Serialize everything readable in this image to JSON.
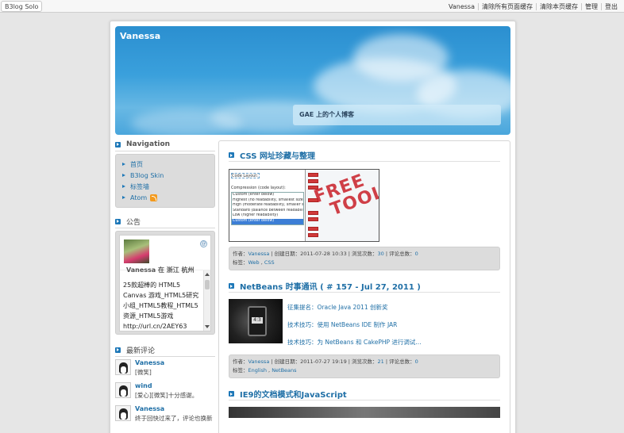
{
  "topbar": {
    "brand": "B3log Solo",
    "links": [
      "Vanessa",
      "清除所有页面缓存",
      "清除本页缓存",
      "管理",
      "登出"
    ]
  },
  "header": {
    "title": "Vanessa",
    "subtitle": "GAE 上的个人博客"
  },
  "sidebar": {
    "navigation": {
      "title": "Navigation",
      "items": [
        "首页",
        "B3log Skin",
        "标签墙",
        "Atom"
      ]
    },
    "notice": {
      "title": "公告",
      "widget_name": "Vanessa 在 浙江 杭州",
      "widget_text": "25款超棒的 HTML5 Canvas 游戏_HTML5研究小组_HTML5教程_HTML5资源_HTML5游戏 http://url.cn/2AEY63"
    },
    "recent_comments": {
      "title": "最新评论",
      "items": [
        {
          "name": "Vanessa",
          "text": "[微笑]"
        },
        {
          "name": "wind",
          "text": "[爱心][微笑]十分感谢。"
        },
        {
          "name": "Vanessa",
          "text": "终于回快过来了，评论也换新"
        }
      ]
    }
  },
  "posts": [
    {
      "title": "CSS 网址珍藏与整理",
      "meta_author_label": "作者：",
      "author": "Vanessa",
      "meta_created": " | 创建日期：2011-07-28 10:33 | 浏览次数：",
      "views": "30",
      "meta_comments": " | 评论总数：",
      "comments": "0",
      "tags_label": "标签：",
      "tags": [
        "Web",
        "CSS"
      ],
      "image": {
        "code_layout": "Code Layout:",
        "compression_label": "Compression (code layout):",
        "select_value": "Custom (enter below)",
        "options": [
          "Custom (enter below)",
          "Highest (no readability, smallest size)",
          "High (moderate readability, smaller size)",
          "Standard (balance between readability",
          "Low (higher readability)",
          "Custom (enter below)"
        ],
        "stamp_line1": "FREE",
        "stamp_line2": "TOOL"
      }
    },
    {
      "title": "NetBeans 时事通讯 ( # 157 - Jul 27, 2011 )",
      "links": [
        "征集提名：Oracle Java 2011 创新奖",
        "技术技巧：使用 NetBeans IDE 制作 JAR",
        "技术技巧：为 NetBeans 和 CakePHP 进行调试..."
      ],
      "phone_text": "4:3",
      "meta_author_label": "作者：",
      "author": "Vanessa",
      "meta_created": " | 创建日期：2011-07-27 19:19 | 浏览次数：",
      "views": "21",
      "meta_comments": " | 评论总数：",
      "comments": "0",
      "tags_label": "标签：",
      "tags": [
        "English",
        "NetBeans"
      ]
    },
    {
      "title": "IE9的文档模式和JavaScript"
    }
  ],
  "colors": {
    "accent": "#1f6fa6",
    "header_sky": "#3aa0dc",
    "meta_bg": "#dcdcdc"
  }
}
